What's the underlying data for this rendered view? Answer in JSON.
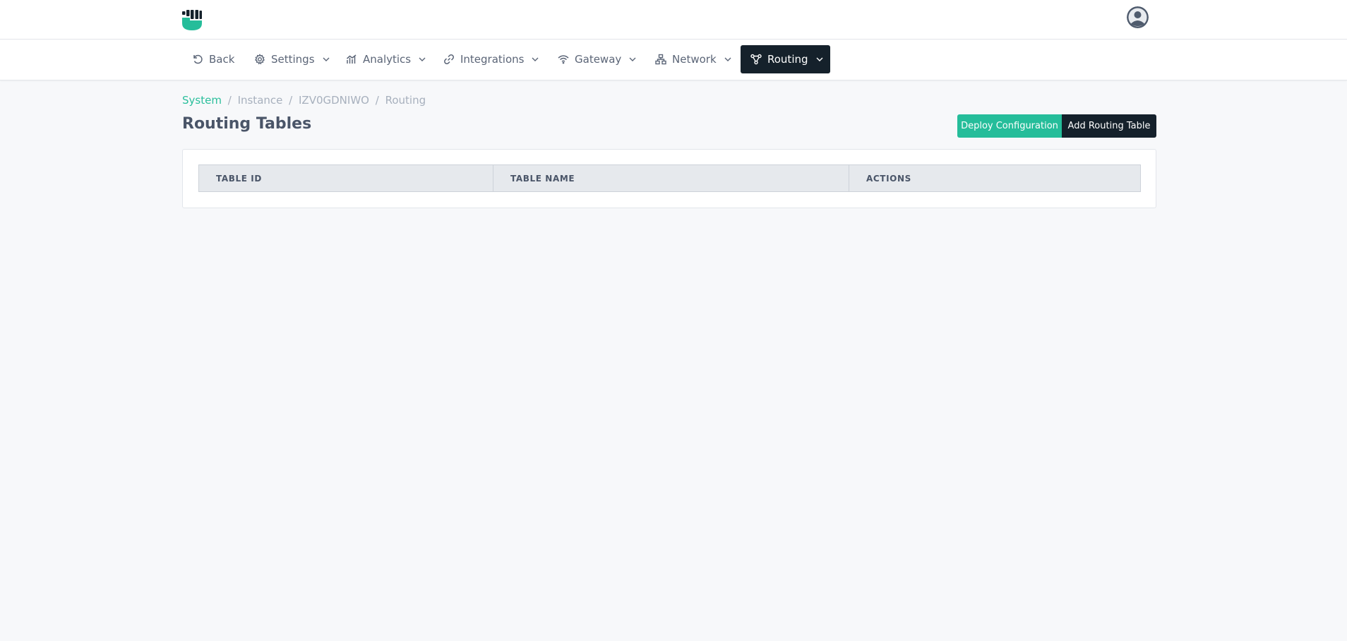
{
  "header": {
    "logo_icon": "fist-shield-logo-icon",
    "avatar_icon": "user-avatar-icon",
    "brand_color": "#25bd9a"
  },
  "nav": {
    "back": {
      "label": "Back",
      "icon": "undo-icon"
    },
    "items": [
      {
        "label": "Settings",
        "icon": "gear-icon"
      },
      {
        "label": "Analytics",
        "icon": "bar-chart-icon"
      },
      {
        "label": "Integrations",
        "icon": "link-icon"
      },
      {
        "label": "Gateway",
        "icon": "wifi-icon"
      },
      {
        "label": "Network",
        "icon": "network-icon"
      },
      {
        "label": "Routing",
        "icon": "routing-icon",
        "active": true
      }
    ],
    "active_color": "#15212b"
  },
  "breadcrumb": {
    "items": [
      "System",
      "Instance",
      "IZV0GDNIWO",
      "Routing"
    ],
    "separator": "/"
  },
  "page": {
    "title": "Routing Tables",
    "deploy_label": "Deploy Configuration",
    "add_label": "Add Routing Table"
  },
  "table": {
    "columns": [
      "TABLE ID",
      "TABLE NAME",
      "ACTIONS"
    ],
    "rows": []
  }
}
